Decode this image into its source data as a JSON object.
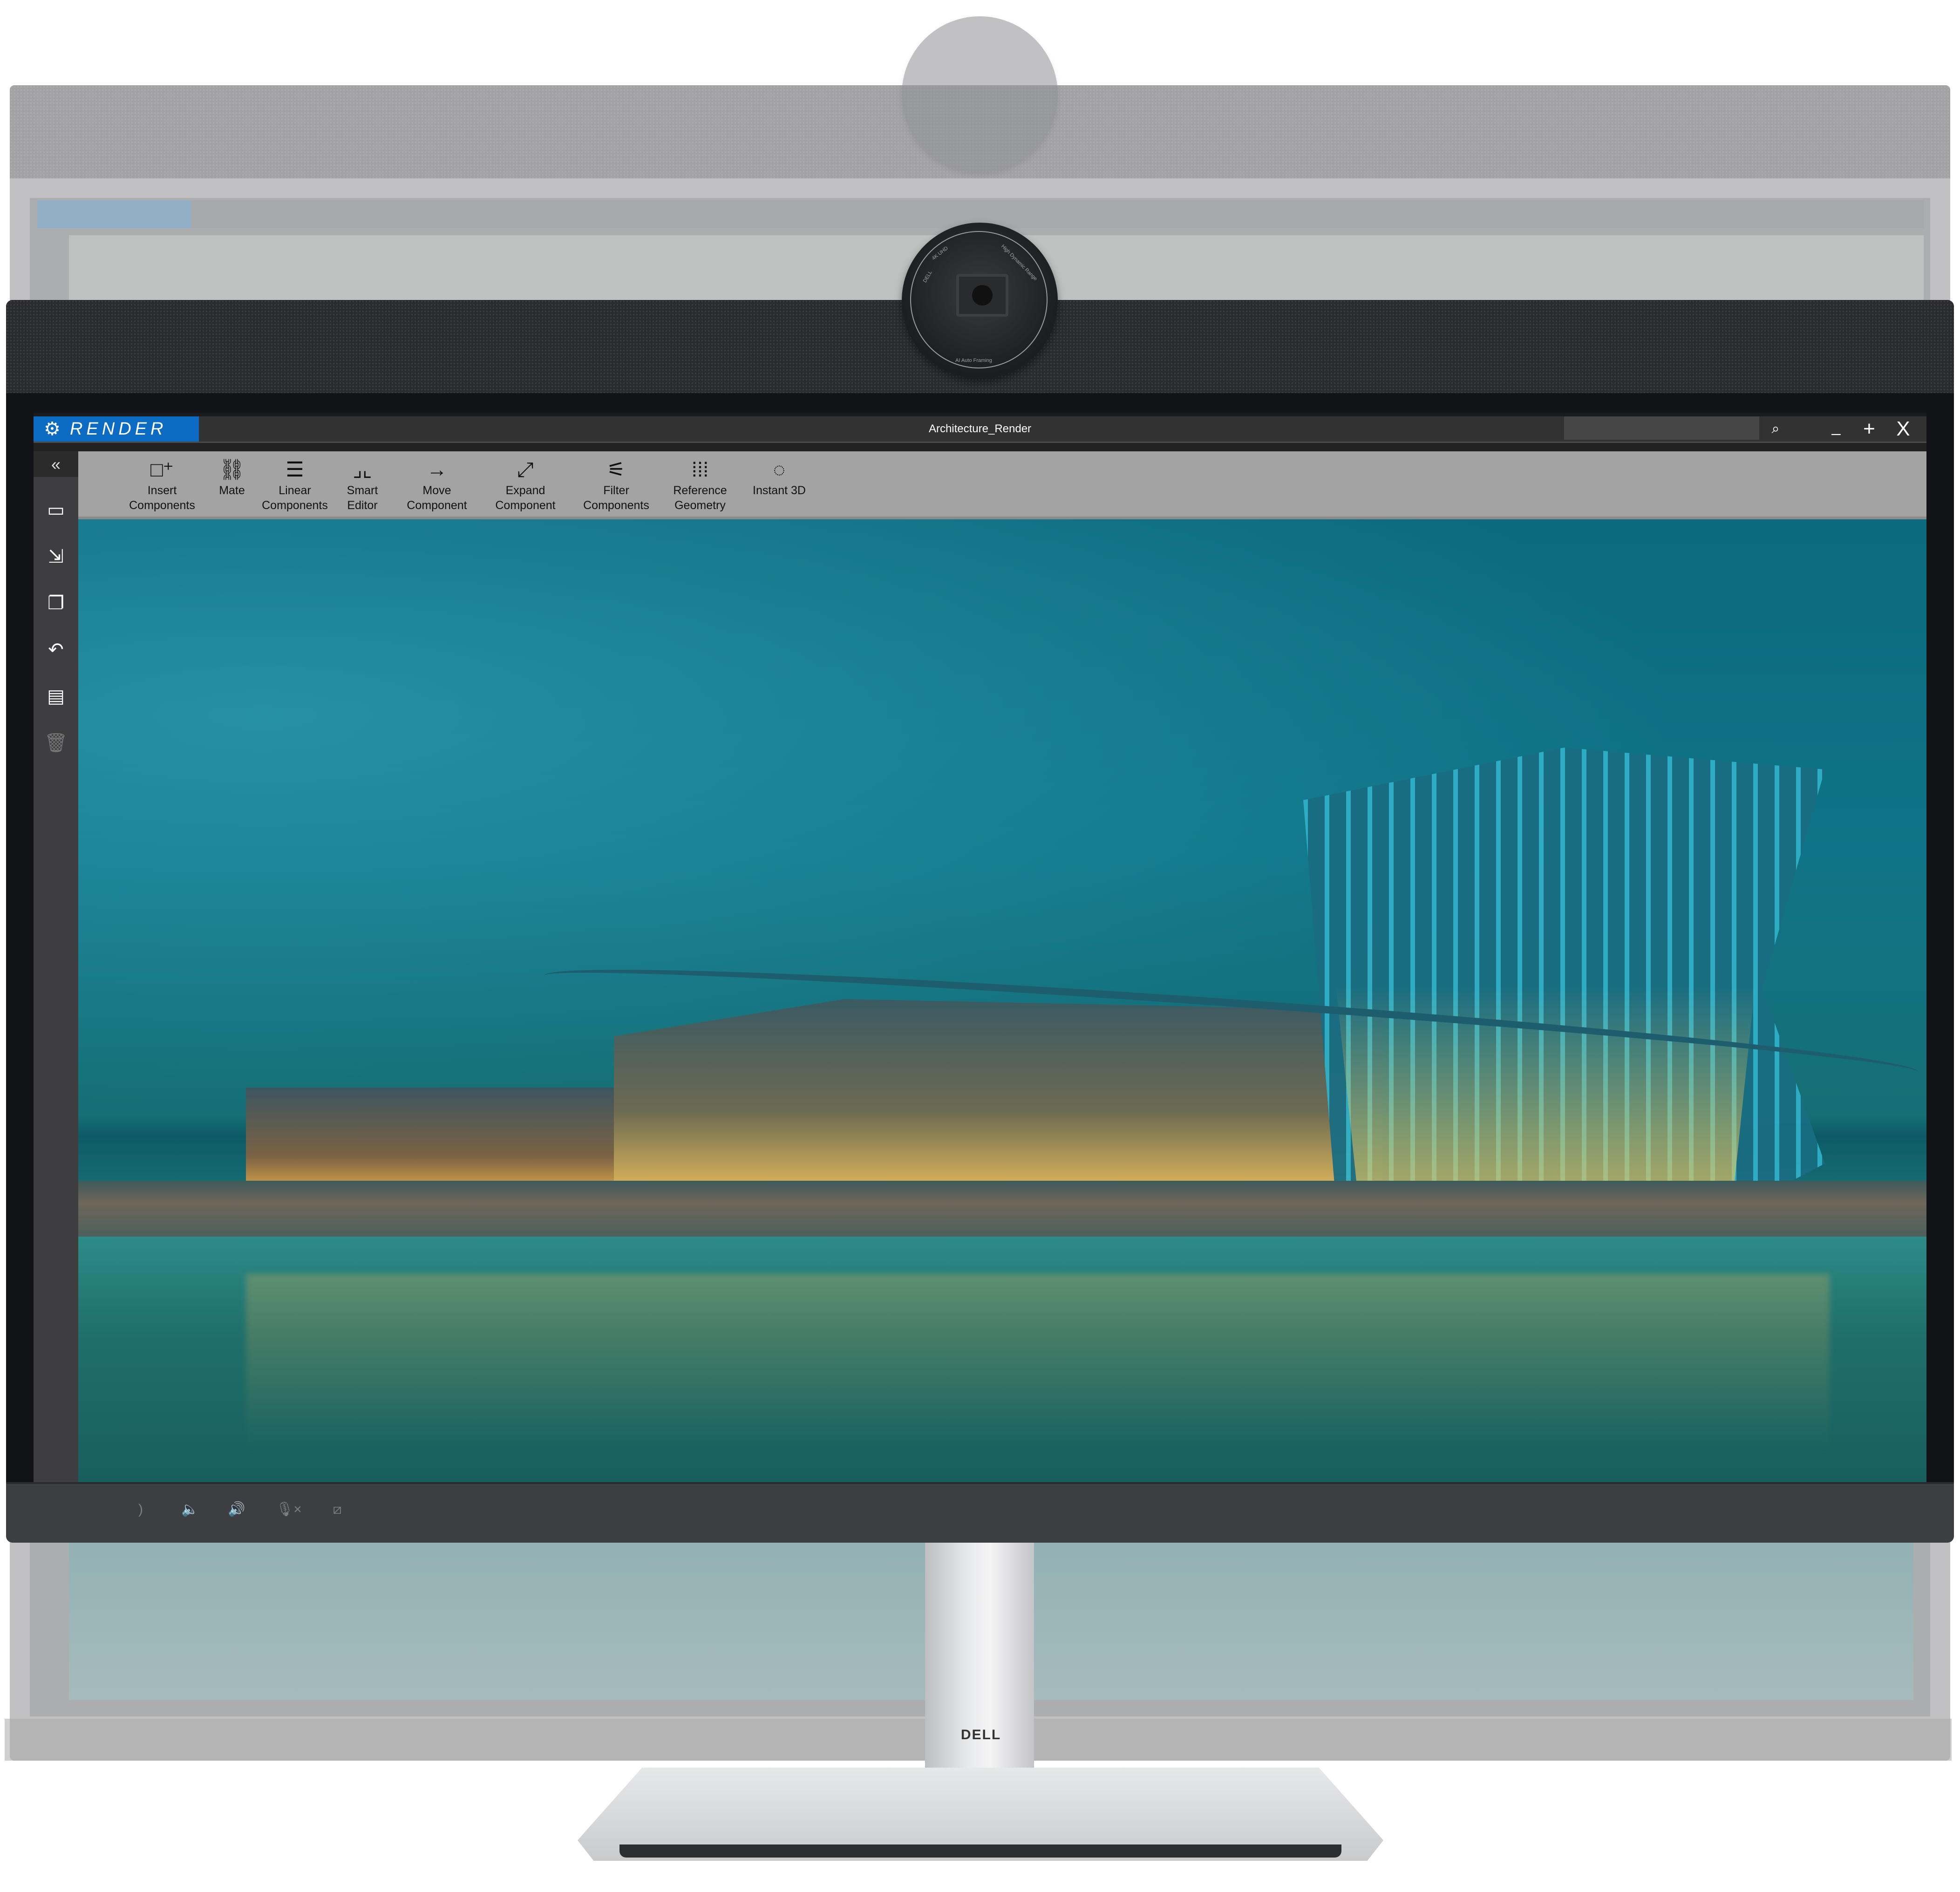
{
  "app": {
    "name": "RENDER",
    "window_title": "Architecture_Render",
    "search": {
      "placeholder": "",
      "value": ""
    },
    "window_controls": {
      "minimize": "_",
      "maximize": "+",
      "close": "X"
    }
  },
  "icons": {
    "logo": "⚙",
    "search": "🔍",
    "collapse": "«"
  },
  "toolbar": {
    "items": [
      {
        "label_line1": "Insert",
        "label_line2": "Components",
        "icon": "□⁺"
      },
      {
        "label_line1": "Mate",
        "label_line2": "",
        "icon": "⛓"
      },
      {
        "label_line1": "Linear",
        "label_line2": "Components",
        "icon": "☰"
      },
      {
        "label_line1": "Smart",
        "label_line2": "Editor",
        "icon": "⌟⌞"
      },
      {
        "label_line1": "Move",
        "label_line2": "Component",
        "icon": "→"
      },
      {
        "label_line1": "Expand",
        "label_line2": "Component",
        "icon": "⤢"
      },
      {
        "label_line1": "Filter",
        "label_line2": "Components",
        "icon": "⚟"
      },
      {
        "label_line1": "Reference",
        "label_line2": "Geometry",
        "icon": "⁞⁞⁞"
      },
      {
        "label_line1": "Instant 3D",
        "label_line2": "",
        "icon": "◌"
      }
    ]
  },
  "sidebar": {
    "items": [
      {
        "name": "select-rectangle",
        "icon": "▭"
      },
      {
        "name": "import",
        "icon": "⇲"
      },
      {
        "name": "windows",
        "icon": "❐"
      },
      {
        "name": "undo",
        "icon": "↶"
      },
      {
        "name": "document",
        "icon": "▤"
      },
      {
        "name": "delete",
        "icon": "🗑"
      }
    ]
  },
  "camera": {
    "brand": "DELL",
    "label_resolution": "4K UHD",
    "label_hdr": "High Dynamic Range",
    "label_framing": "AI Auto Framing"
  },
  "bezel_buttons": [
    {
      "name": "call",
      "icon": ")"
    },
    {
      "name": "volume-down",
      "icon": "🔈"
    },
    {
      "name": "volume-up",
      "icon": "🔊"
    },
    {
      "name": "mic-mute",
      "icon": "🎙×"
    },
    {
      "name": "camera-off",
      "icon": "⧄"
    }
  ],
  "monitor": {
    "brand": "DELL"
  }
}
